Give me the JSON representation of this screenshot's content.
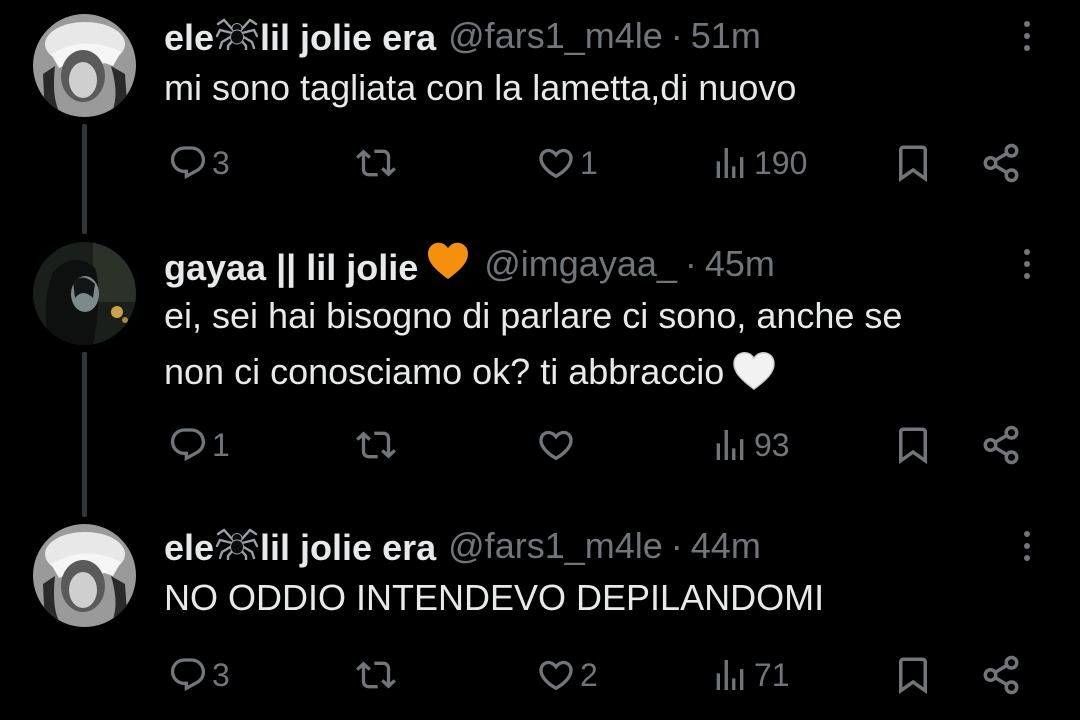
{
  "tweets": [
    {
      "display_name_a": "ele",
      "display_name_b": "lil jolie era",
      "name_emoji": "spider-icon",
      "handle": "@fars1_m4le",
      "dot": "·",
      "time": "51m",
      "text": "mi sono tagliata con la lametta,di nuovo",
      "replies": "3",
      "retweets": "",
      "likes": "1",
      "views": "190"
    },
    {
      "display_name": "gayaa || lil jolie",
      "name_emoji": "orange-heart-icon",
      "handle": "@imgayaa_",
      "dot": "·",
      "time": "45m",
      "text_line1": "ei, sei hai bisogno di parlare ci sono, anche se",
      "text_line2": "non ci conosciamo ok? ti abbraccio",
      "text_emoji": "white-heart-icon",
      "replies": "1",
      "retweets": "",
      "likes": "",
      "views": "93"
    },
    {
      "display_name_a": "ele",
      "display_name_b": "lil jolie era",
      "name_emoji": "spider-icon",
      "handle": "@fars1_m4le",
      "dot": "·",
      "time": "44m",
      "text": "NO ODDIO INTENDEVO DEPILANDOMI",
      "replies": "3",
      "retweets": "",
      "likes": "2",
      "views": "71"
    }
  ],
  "colors": {
    "background": "#000000",
    "primary_text": "#e7e9ea",
    "secondary_text": "#71767b",
    "thread_line": "#333639",
    "orange_heart": "#f4900c"
  }
}
